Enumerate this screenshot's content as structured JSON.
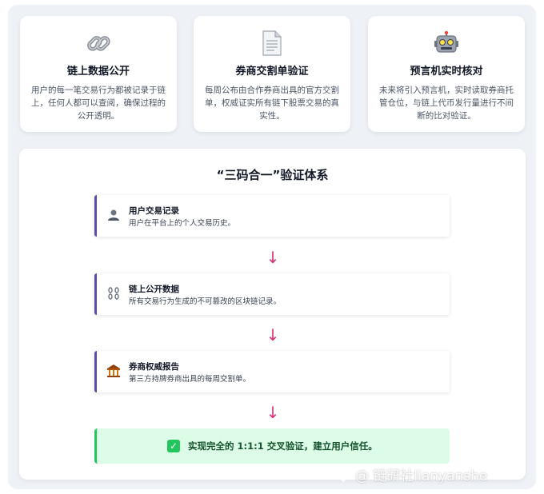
{
  "cards": [
    {
      "icon": "chain-link-icon",
      "title": "链上数据公开",
      "desc": "用户的每一笔交易行为都被记录于链上，任何人都可以查阅，确保过程的公开透明。"
    },
    {
      "icon": "document-icon",
      "title": "券商交割单验证",
      "desc": "每周公布由合作券商出具的官方交割单，权威证实所有链下股票交易的真实性。"
    },
    {
      "icon": "robot-icon",
      "title": "预言机实时核对",
      "desc": "未来将引入预言机，实时读取券商托管仓位，与链上代币发行量进行不间断的比对验证。"
    }
  ],
  "panel": {
    "title": "“三码合一”验证体系",
    "steps": [
      {
        "icon": "user-icon",
        "title": "用户交易记录",
        "desc": "用户在平台上的个人交易历史。"
      },
      {
        "icon": "chain-icon",
        "title": "链上公开数据",
        "desc": "所有交易行为生成的不可篡改的区块链记录。"
      },
      {
        "icon": "bank-icon",
        "title": "券商权威报告",
        "desc": "第三方持牌券商出具的每周交割单。"
      }
    ],
    "arrow": "↓",
    "result": {
      "check": "✓",
      "text": "实现完全的 1:1:1 交叉验证，建立用户信任。"
    }
  },
  "watermark": {
    "text": "@ 链研社lianyanshe"
  },
  "colors": {
    "accent": "#5b4aa8",
    "arrow": "#d6337a",
    "success_bg": "#dcfce7",
    "success": "#22c55e"
  }
}
